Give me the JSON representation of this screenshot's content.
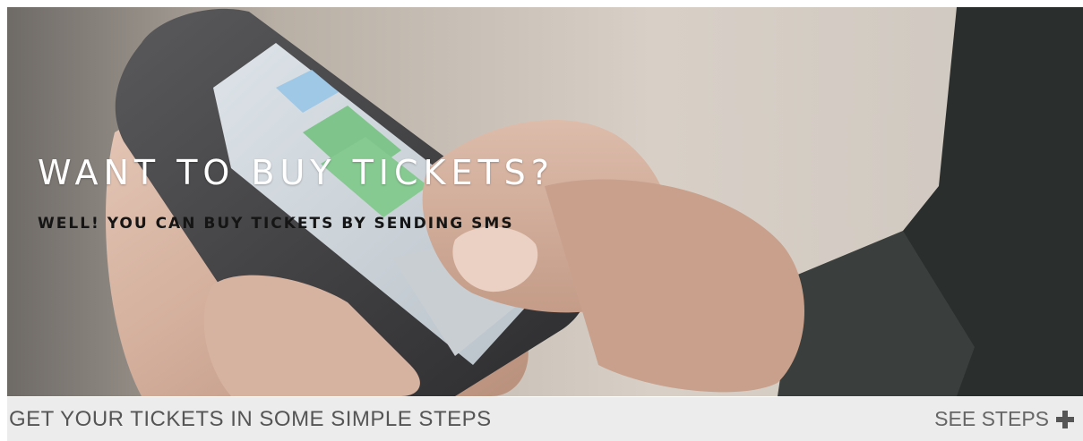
{
  "hero": {
    "title": "WANT TO BUY TICKETS?",
    "subtitle": "WELL! YOU CAN BUY TICKETS BY SENDING SMS",
    "title_color": "#ffffff",
    "subtitle_color": "#151515"
  },
  "steps_bar": {
    "text": "GET YOUR TICKETS IN SOME SIMPLE STEPS",
    "see_steps_label": "SEE STEPS",
    "see_steps_icon": "plus-icon",
    "background": "#ececec"
  }
}
